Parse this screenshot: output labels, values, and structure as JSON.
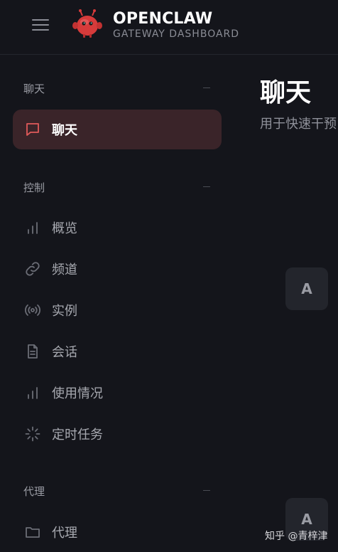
{
  "header": {
    "title": "OPENCLAW",
    "subtitle": "GATEWAY DASHBOARD",
    "menu_icon": "hamburger-icon",
    "logo_icon": "red-crab-mascot-logo"
  },
  "sidebar": {
    "groups": [
      {
        "label": "聊天",
        "toggle": "–",
        "items": [
          {
            "label": "聊天",
            "icon": "chat-bubble-icon",
            "active": true
          }
        ]
      },
      {
        "label": "控制",
        "toggle": "–",
        "items": [
          {
            "label": "概览",
            "icon": "bar-chart-icon"
          },
          {
            "label": "频道",
            "icon": "link-icon"
          },
          {
            "label": "实例",
            "icon": "broadcast-icon"
          },
          {
            "label": "会话",
            "icon": "document-icon"
          },
          {
            "label": "使用情况",
            "icon": "bar-chart-icon"
          },
          {
            "label": "定时任务",
            "icon": "loader-icon"
          }
        ]
      },
      {
        "label": "代理",
        "toggle": "–",
        "items": [
          {
            "label": "代理",
            "icon": "folder-icon"
          }
        ]
      }
    ]
  },
  "main": {
    "title": "聊天",
    "subtitle": "用于快速干预",
    "avatars": [
      "A",
      "A"
    ]
  },
  "watermark": "知乎 @青梓津",
  "colors": {
    "background": "#14151b",
    "active_item_bg": "#3a2429",
    "accent_red": "#e05a5a"
  }
}
